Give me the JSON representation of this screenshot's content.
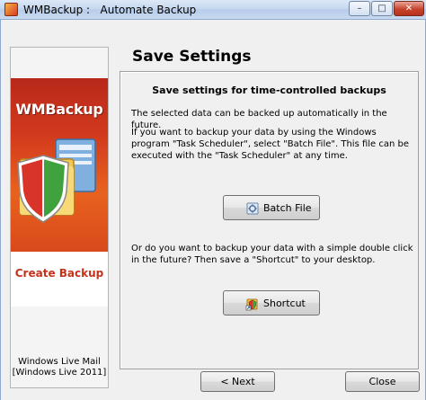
{
  "window": {
    "title": "WMBackup :   Automate Backup",
    "minimize_glyph": "–",
    "maximize_glyph": "□",
    "close_glyph": "✕"
  },
  "sidebar": {
    "banner_title": "WMBackup",
    "banner_subtitle": "Create Backup",
    "caption_line1": "Windows Live Mail",
    "caption_line2": "[Windows Live 2011]"
  },
  "main": {
    "heading": "Save Settings",
    "section_title": "Save settings for time-controlled backups",
    "para1": "The selected data can be backed up automatically in the future.",
    "para2": "If you want to backup your data by using the Windows program \"Task Scheduler\", select \"Batch File\". This file can be executed with the \"Task Scheduler\" at any time.",
    "batch_button": "Batch File",
    "para3": "Or do you want to backup your data with a simple double click in the future? Then save a \"Shortcut\" to your desktop.",
    "shortcut_button": "Shortcut"
  },
  "footer": {
    "next_button": "< Next",
    "close_button": "Close"
  },
  "colors": {
    "banner_red": "#d23a1d",
    "banner_text_red": "#c4321c"
  }
}
